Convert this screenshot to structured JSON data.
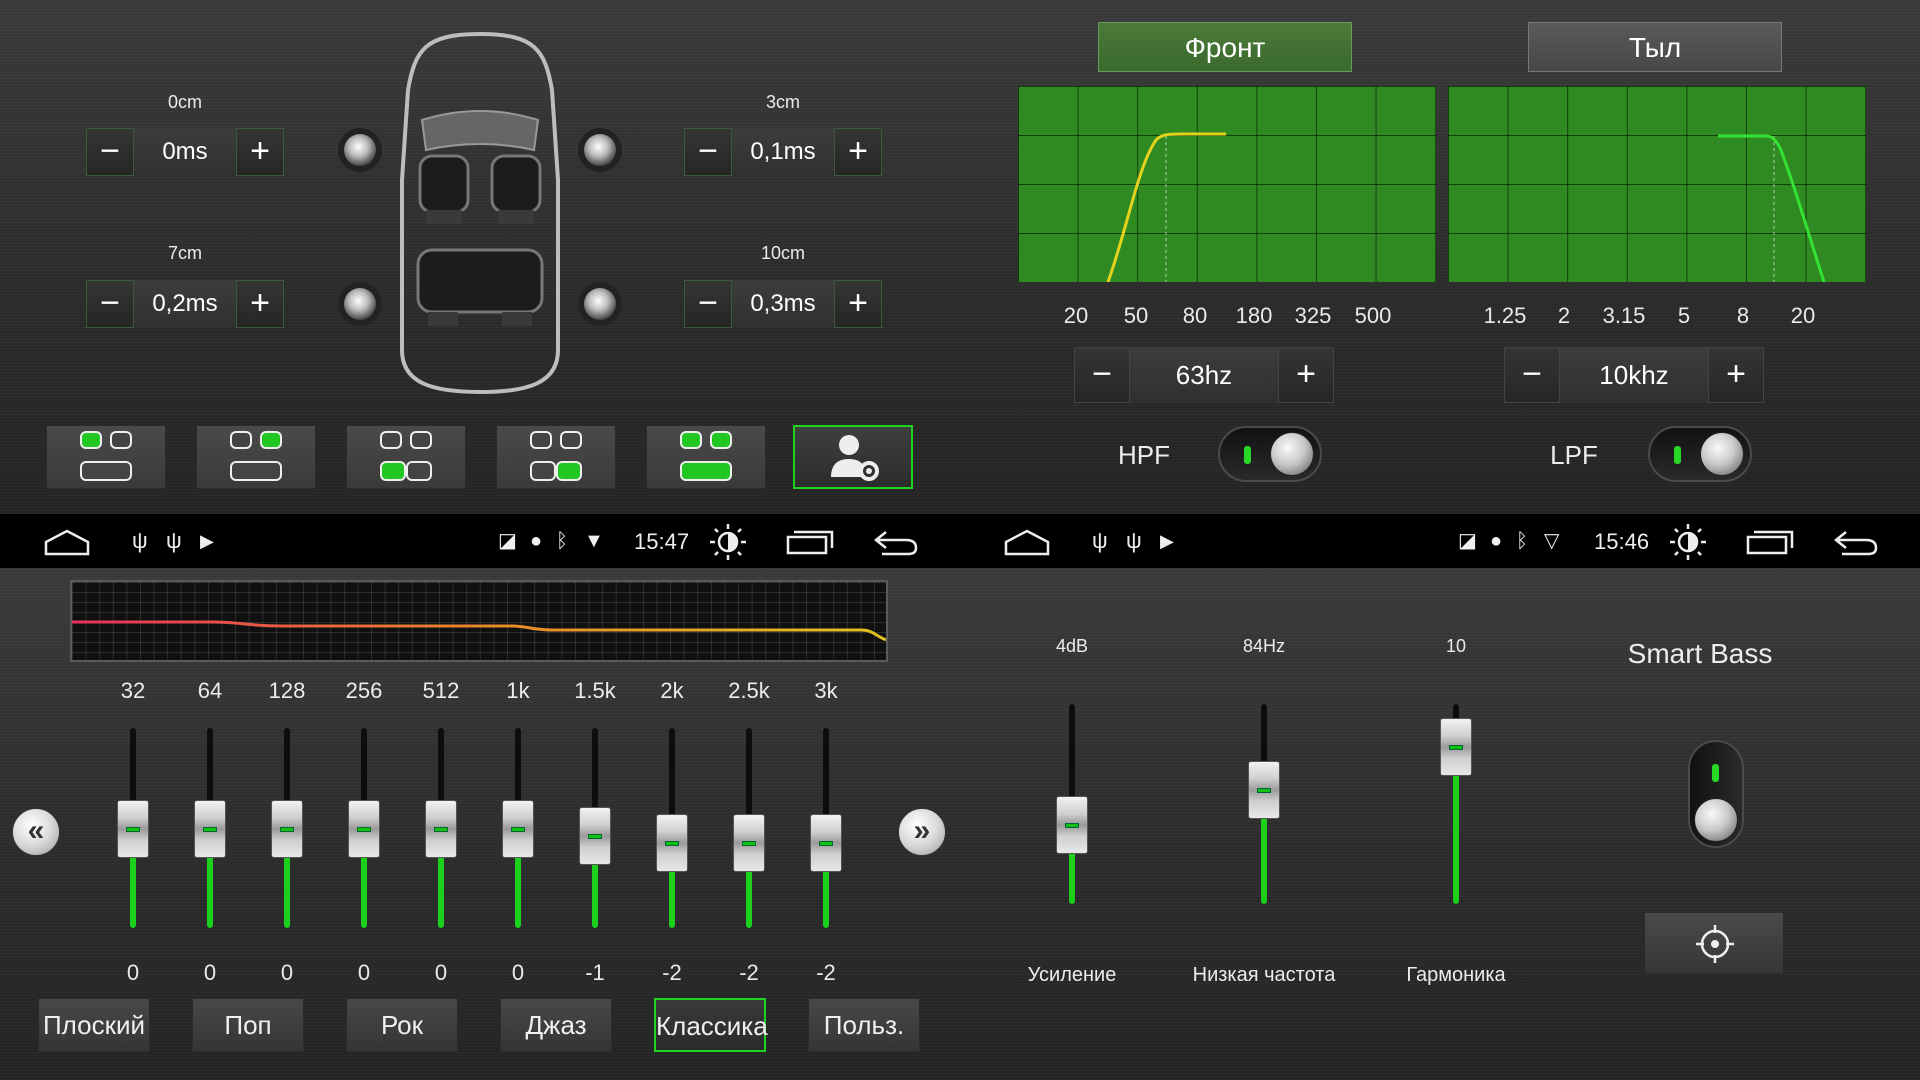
{
  "theme": {
    "accent": "#1fd21f",
    "graph_bg": "#2f8a22",
    "hpf_curve": "#e3d21e",
    "lpf_curve": "#33e233",
    "eq_line_left": "#e8315c",
    "eq_line_right": "#e3c222"
  },
  "delay": {
    "fl": {
      "distance": "0cm",
      "value": "0ms"
    },
    "fr": {
      "distance": "3cm",
      "value": "0,1ms"
    },
    "rl": {
      "distance": "7cm",
      "value": "0,2ms"
    },
    "rr": {
      "distance": "10cm",
      "value": "0,3ms"
    },
    "minus_symbol": "−",
    "plus_symbol": "+"
  },
  "seat_presets": [
    {
      "name": "front-left",
      "active": false
    },
    {
      "name": "front-right",
      "active": false
    },
    {
      "name": "rear-left",
      "active": false
    },
    {
      "name": "rear-right",
      "active": false
    },
    {
      "name": "front-both",
      "active": false
    },
    {
      "name": "user-settings",
      "active": true,
      "icon": "user-gear-icon"
    }
  ],
  "crossover": {
    "tabs": {
      "front": "Фронт",
      "rear": "Тыл",
      "active": "front"
    },
    "hpf": {
      "scale": [
        "20",
        "50",
        "80",
        "180",
        "325",
        "500"
      ],
      "value": "63hz",
      "label": "HPF",
      "enabled": true
    },
    "lpf": {
      "scale": [
        "1.25",
        "2",
        "3.15",
        "5",
        "8",
        "20"
      ],
      "value": "10khz",
      "label": "LPF",
      "enabled": true
    }
  },
  "statusbar_left": {
    "time": "15:47"
  },
  "statusbar_right": {
    "time": "15:46"
  },
  "equalizer": {
    "bands": [
      {
        "freq": "32",
        "gain": "0",
        "level": 0
      },
      {
        "freq": "64",
        "gain": "0",
        "level": 0
      },
      {
        "freq": "128",
        "gain": "0",
        "level": 0
      },
      {
        "freq": "256",
        "gain": "0",
        "level": 0
      },
      {
        "freq": "512",
        "gain": "0",
        "level": 0
      },
      {
        "freq": "1k",
        "gain": "0",
        "level": 0
      },
      {
        "freq": "1.5k",
        "gain": "-1",
        "level": -1
      },
      {
        "freq": "2k",
        "gain": "-2",
        "level": -2
      },
      {
        "freq": "2.5k",
        "gain": "-2",
        "level": -2
      },
      {
        "freq": "3k",
        "gain": "-2",
        "level": -2
      }
    ],
    "presets": [
      {
        "label": "Плоский",
        "active": false
      },
      {
        "label": "Поп",
        "active": false
      },
      {
        "label": "Рок",
        "active": false
      },
      {
        "label": "Джаз",
        "active": false
      },
      {
        "label": "Классика",
        "active": true
      },
      {
        "label": "Польз.",
        "active": false
      }
    ],
    "prev_symbol": "«",
    "next_symbol": "»"
  },
  "smart_bass": {
    "title": "Smart Bass",
    "enabled": true,
    "sliders": [
      {
        "label": "Усиление",
        "value": "4dB",
        "fill": 0.35
      },
      {
        "label": "Низкая частота",
        "value": "84Hz",
        "fill": 0.6
      },
      {
        "label": "Гармоника",
        "value": "10",
        "fill": 0.9
      }
    ],
    "target_icon": "crosshair-icon"
  }
}
